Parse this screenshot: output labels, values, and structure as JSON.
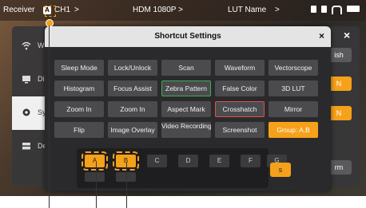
{
  "topbar": {
    "receiver": "Receiver",
    "badge": "A",
    "channel": "CH1",
    "video_mode": "HDM 1080P >",
    "lut_name": "LUT Name",
    "arrows": ">"
  },
  "sidebar": {
    "items": [
      {
        "label": "Wi",
        "icon": "wifi-icon"
      },
      {
        "label": "Di",
        "icon": "display-icon"
      },
      {
        "label": "Sy",
        "icon": "gear-icon"
      },
      {
        "label": "De",
        "icon": "device-icon"
      }
    ]
  },
  "background_buttons": {
    "finish": "ish",
    "on1": "N",
    "on2": "N",
    "s": "s",
    "rm": "rm"
  },
  "dialog": {
    "title": "Shortcut Settings",
    "close": "×",
    "shortcuts": [
      "Sleep Mode",
      "Lock/Unlock",
      "Scan",
      "Waveform",
      "Vectorscope",
      "Histogram",
      "Focus Assist",
      "Zebra Pattern",
      "False Color",
      "3D LUT",
      "Zoom In",
      "Zoom In",
      "Aspect Mark",
      "Crosshatch",
      "Mirror",
      "Flip",
      "Image Overlay",
      "Video Recording",
      "Screenshot",
      "Group: A,B"
    ],
    "groups": [
      "A",
      "B",
      "C",
      "D",
      "E",
      "F",
      "G"
    ],
    "selected_groups": [
      "A",
      "B"
    ]
  },
  "colors": {
    "accent": "#f5a11a",
    "zebra_border": "#3fae5a",
    "crosshatch_border": "#d9534f"
  }
}
